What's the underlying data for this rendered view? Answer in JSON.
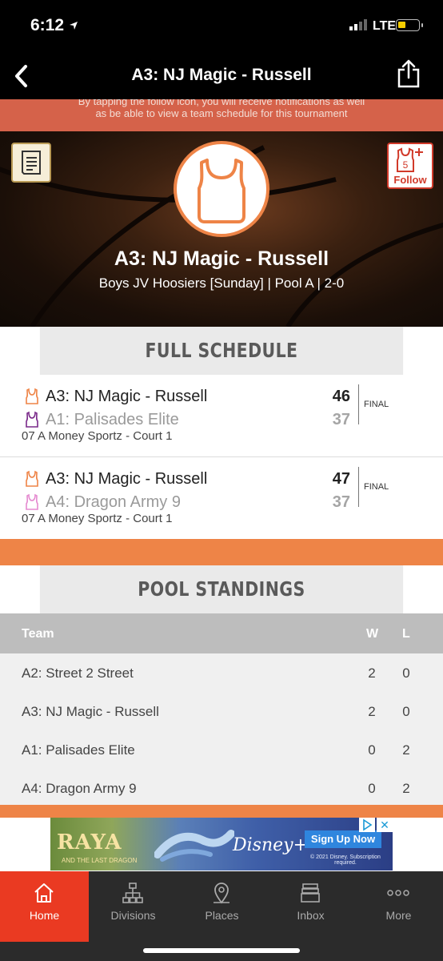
{
  "status_bar": {
    "time": "6:12",
    "network": "LTE"
  },
  "nav": {
    "title": "A3: NJ Magic - Russell",
    "back_icon": "chevron-left-icon",
    "share_icon": "share-icon"
  },
  "banner": {
    "line1": "By tapping the follow icon, you will receive notifications as well",
    "line2": "as be able to view a team schedule for this tournament"
  },
  "hero": {
    "team_name": "A3: NJ Magic - Russell",
    "subtitle": "Boys JV Hoosiers [Sunday] | Pool A | 2-0",
    "follow_label": "Follow",
    "follow_badge": "5",
    "accent_color": "#ee8447"
  },
  "schedule": {
    "heading": "FULL SCHEDULE",
    "games": [
      {
        "team1": "A3: NJ Magic - Russell",
        "score1": "46",
        "team2": "A1: Palisades Elite",
        "score2": "37",
        "venue": "07 A Money Sportz - Court 1",
        "status": "FINAL",
        "jersey1_color": "#ee8447",
        "jersey2_color": "#7a2a8a"
      },
      {
        "team1": "A3: NJ Magic - Russell",
        "score1": "47",
        "team2": "A4: Dragon Army 9",
        "score2": "37",
        "venue": "07 A Money Sportz - Court 1",
        "status": "FINAL",
        "jersey1_color": "#ee8447",
        "jersey2_color": "#e58ad0"
      }
    ]
  },
  "standings": {
    "heading": "POOL STANDINGS",
    "columns": {
      "team": "Team",
      "w": "W",
      "l": "L"
    },
    "rows": [
      {
        "team": "A2: Street 2 Street",
        "w": "2",
        "l": "0"
      },
      {
        "team": "A3: NJ Magic - Russell",
        "w": "2",
        "l": "0"
      },
      {
        "team": "A1: Palisades Elite",
        "w": "0",
        "l": "2"
      },
      {
        "team": "A4: Dragon Army 9",
        "w": "0",
        "l": "2"
      }
    ]
  },
  "ad": {
    "brand": "RAYA",
    "brand_sub": "AND THE LAST DRAGON",
    "service": "Disney+",
    "cta": "Sign Up Now",
    "copyright": "© 2021 Disney. Subscription required.",
    "close": "✕"
  },
  "tabbar": {
    "items": [
      {
        "label": "Home",
        "icon": "home-icon",
        "active": true
      },
      {
        "label": "Divisions",
        "icon": "hierarchy-icon",
        "active": false
      },
      {
        "label": "Places",
        "icon": "map-pin-icon",
        "active": false
      },
      {
        "label": "Inbox",
        "icon": "inbox-icon",
        "active": false
      },
      {
        "label": "More",
        "icon": "more-dots-icon",
        "active": false
      }
    ]
  }
}
